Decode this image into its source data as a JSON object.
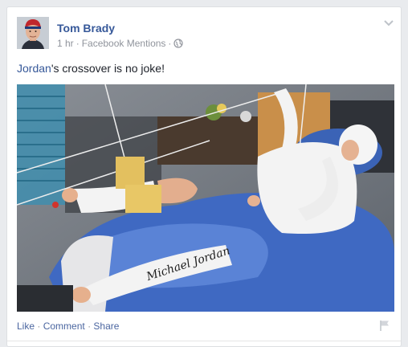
{
  "post": {
    "author": "Tom Brady",
    "time": "1 hr",
    "separator": "·",
    "source": "Facebook Mentions",
    "text_link": "Jordan",
    "text_rest": "'s crossover is no joke!"
  },
  "photo": {
    "signature": "Michael Jordan"
  },
  "actions": {
    "like": "Like",
    "comment": "Comment",
    "share": "Share",
    "dot": "·"
  },
  "icons": {
    "globe": "globe-icon",
    "chevron": "chevron-down-icon",
    "flag": "flag-icon"
  },
  "colors": {
    "link": "#365899",
    "action": "#4b66a0",
    "meta": "#90949c"
  }
}
